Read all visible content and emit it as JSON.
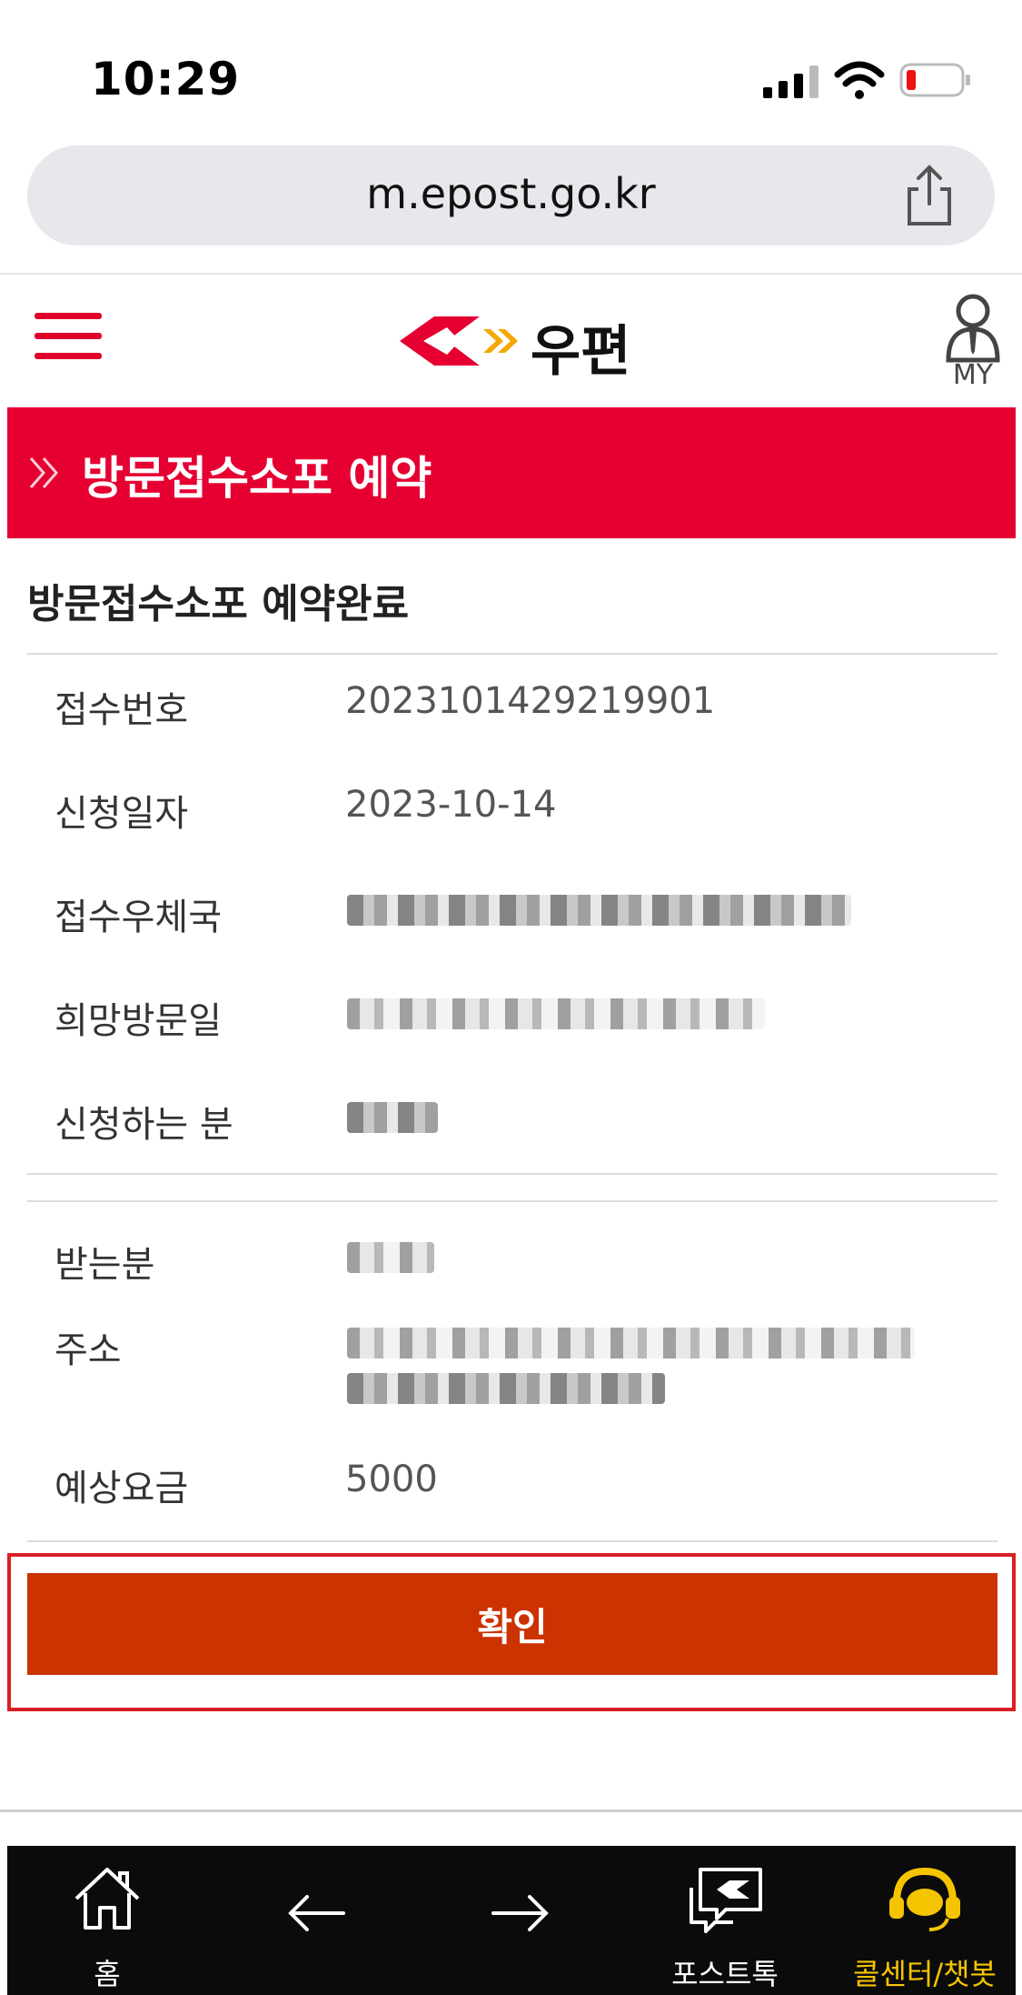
{
  "status_bar": {
    "time": "10:29"
  },
  "browser": {
    "url": "m.epost.go.kr"
  },
  "header": {
    "logo_text": "우편",
    "my_label": "MY"
  },
  "title_bar": {
    "title": "방문접수소포 예약"
  },
  "section": {
    "title": "방문접수소포 예약완료"
  },
  "info_rows": [
    {
      "label": "접수번호",
      "value": "2023101429219901"
    },
    {
      "label": "신청일자",
      "value": "2023-10-14"
    },
    {
      "label": "접수우체국",
      "value": ""
    },
    {
      "label": "희망방문일",
      "value": ""
    },
    {
      "label": "신청하는 분",
      "value": ""
    }
  ],
  "recipient_rows": [
    {
      "label": "받는분",
      "value": ""
    },
    {
      "label": "주소",
      "value": ""
    },
    {
      "label": "예상요금",
      "value": "5000"
    }
  ],
  "confirm_button": {
    "label": "확인"
  },
  "bottom_nav": {
    "home": "홈",
    "posttalk": "포스트톡",
    "callcenter": "콜센터/챗봇"
  },
  "colors": {
    "brand_red": "#e60032",
    "button_red": "#cc3300",
    "callcenter_yellow": "#f5c400"
  }
}
